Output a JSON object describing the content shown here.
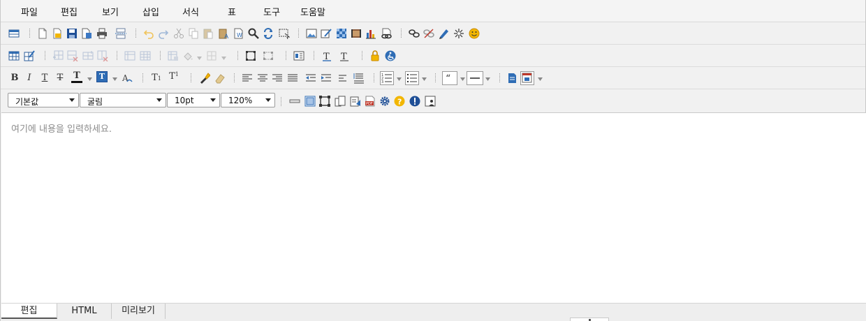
{
  "menubar": {
    "items": [
      "파일",
      "편집",
      "보기",
      "삽입",
      "서식",
      "표",
      "도구",
      "도움말"
    ]
  },
  "format_bar": {
    "bold": "B",
    "italic": "I",
    "underline": "T",
    "strike": "T",
    "font_color": "T",
    "bg_color": "T",
    "subscript": "T",
    "superscript": "T"
  },
  "selects": {
    "style": "기본값",
    "font": "굴림",
    "size": "10pt",
    "line_height": "120%"
  },
  "content": {
    "placeholder": "여기에 내용을 입력하세요."
  },
  "tabs": [
    "편집",
    "HTML",
    "미리보기"
  ],
  "colors": {
    "toolbar_bg": "#f1f1f1",
    "icon_blue": "#2f6db5",
    "icon_yellow": "#f2b600",
    "icon_red": "#c0392b"
  },
  "icons": {
    "row1": [
      "toggle-toolbar-icon",
      "new-doc-icon",
      "open-icon",
      "save-icon",
      "save-as-icon",
      "print-icon",
      "page-break-icon",
      "undo-icon",
      "redo-icon",
      "cut-icon",
      "copy-icon",
      "paste-icon",
      "paste-text-icon",
      "paste-word-icon",
      "find-icon",
      "replace-icon",
      "select-all-icon",
      "image-icon",
      "edit-image-icon",
      "background-icon",
      "media-icon",
      "chart-icon",
      "link-image-icon",
      "link-icon",
      "unlink-icon",
      "bookmark-icon",
      "special-char-icon",
      "emoticon-icon"
    ],
    "row2": [
      "table-icon",
      "table-props-icon",
      "insert-row-icon",
      "delete-row-icon",
      "merge-cells-icon",
      "delete-col-icon",
      "split-cells-icon",
      "cell-props-icon",
      "cell-bg-icon",
      "border-icon",
      "layer-icon",
      "layer-props-icon",
      "div-box-icon",
      "paragraph-style-icon",
      "text-style-icon",
      "lock-icon",
      "accessibility-icon"
    ],
    "row4": [
      "horizontal-rule-icon",
      "fieldset-icon",
      "full-screen-icon",
      "form-icon",
      "clipboard-icon",
      "pdf-icon",
      "settings-icon",
      "help-icon",
      "info-icon",
      "screen-capture-icon"
    ]
  }
}
